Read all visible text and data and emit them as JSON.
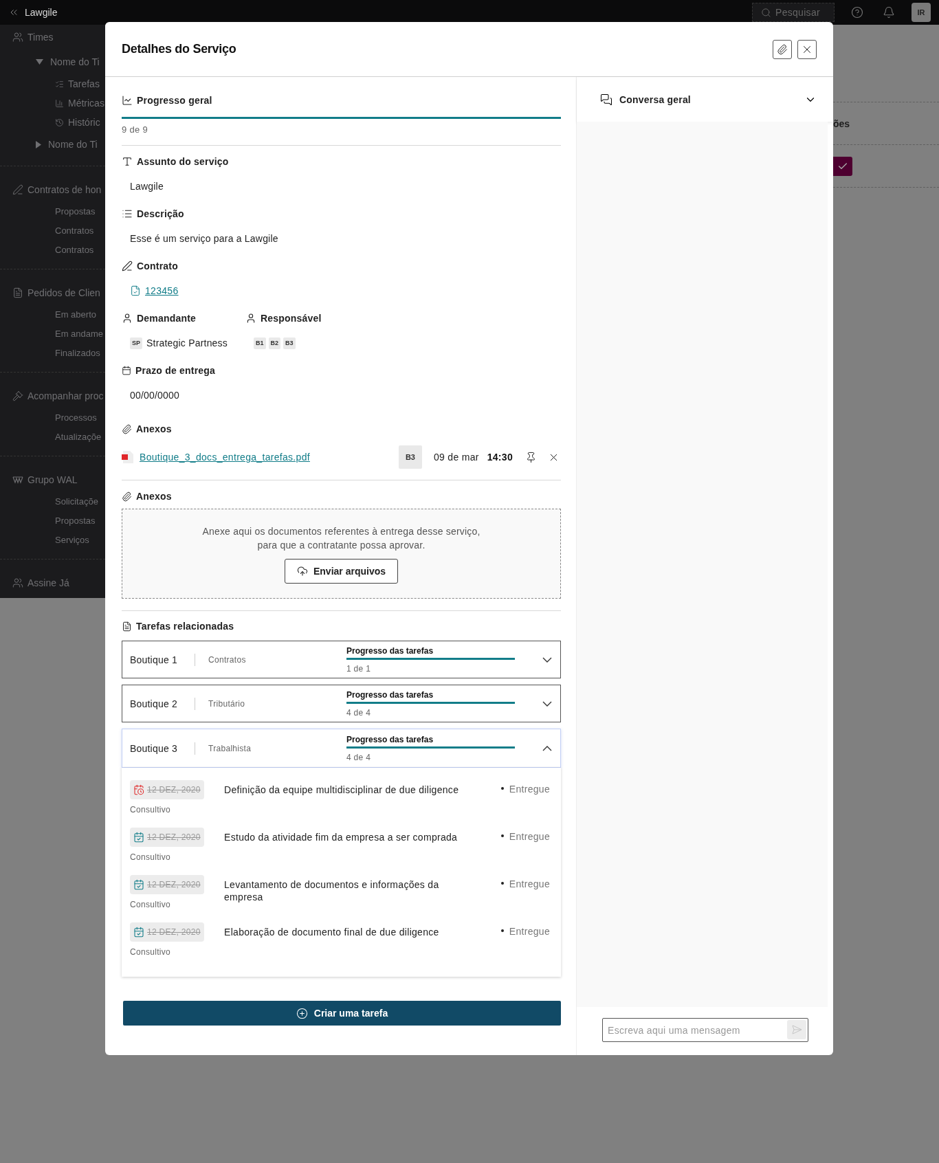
{
  "topbar": {
    "title": "Lawgile",
    "search": {
      "placeholder": "Pesquisar"
    },
    "avatar": "IR"
  },
  "sidebar": {
    "sections": [
      {
        "label": "Times",
        "items": [
          {
            "label": "Nome do Ti",
            "expanded": true,
            "children": [
              {
                "label": "Tarefas"
              },
              {
                "label": "Métricas"
              },
              {
                "label": "Históric"
              }
            ]
          },
          {
            "label": "Nome do Ti",
            "expanded": false
          }
        ]
      },
      {
        "label": "Contratos de hon",
        "items": [
          {
            "label": "Propostas"
          },
          {
            "label": "Contratos"
          },
          {
            "label": "Contratos"
          }
        ]
      },
      {
        "label": "Pedidos de Clien",
        "items": [
          {
            "label": "Em aberto"
          },
          {
            "label": "Em andame"
          },
          {
            "label": "Finalizados"
          }
        ]
      },
      {
        "label": "Acompanhar proc",
        "items": [
          {
            "label": "Processos"
          },
          {
            "label": "Atualizaçõe"
          }
        ]
      },
      {
        "label": "Grupo WAL",
        "items": [
          {
            "label": "Solicitaçõe"
          },
          {
            "label": "Propostas"
          },
          {
            "label": "Serviços"
          }
        ]
      },
      {
        "label": "Assine Já"
      }
    ]
  },
  "background": {
    "heading": "ões"
  },
  "modal": {
    "title": "Detalhes do Serviço",
    "progress": {
      "label": "Progresso geral",
      "level": 1,
      "reading": "9 de 9"
    },
    "subject": {
      "label": "Assunto do serviço",
      "value": "Lawgile"
    },
    "description": {
      "label": "Descrição",
      "value": "Esse é um serviço para a Lawgile"
    },
    "contract": {
      "label": "Contrato",
      "link": "123456"
    },
    "requester": {
      "label": "Demandante",
      "initials": "SP",
      "name": "Strategic Partness"
    },
    "responsible": {
      "label": "Responsável",
      "badges": [
        "B1",
        "B2",
        "B3"
      ]
    },
    "deadline": {
      "label": "Prazo de entrega",
      "value": "00/00/0000"
    },
    "attachments": {
      "label": "Anexos",
      "files": [
        {
          "name": "Boutique_3_docs_entrega_tarefas.pdf",
          "author": "B3",
          "date": "09 de mar",
          "time": "14:30"
        }
      ]
    },
    "upload": {
      "label": "Anexos",
      "hint": [
        "Anexe aqui os documentos referentes à entrega desse serviço,",
        "para que a contratante possa aprovar."
      ],
      "button": "Enviar arquivos"
    },
    "related": {
      "label": "Tarefas relacionadas",
      "groups": [
        {
          "name": "Boutique 1",
          "area": "Contratos",
          "progress_label": "Progresso das tarefas",
          "level": 1,
          "reading": "1 de 1",
          "expanded": false
        },
        {
          "name": "Boutique 2",
          "area": "Tributário",
          "progress_label": "Progresso das tarefas",
          "level": 1,
          "reading": "4 de 4",
          "expanded": false
        },
        {
          "name": "Boutique 3",
          "area": "Trabalhista",
          "progress_label": "Progresso das tarefas",
          "level": 1,
          "reading": "4 de 4",
          "expanded": true,
          "tasks": [
            {
              "kind": "late",
              "date": "12 DEZ, 2020",
              "category": "Consultivo",
              "title": "Definição da equipe multidisciplinar de due diligence",
              "status": "Entregue"
            },
            {
              "kind": "done",
              "date": "12 DEZ, 2020",
              "category": "Consultivo",
              "title": "Estudo da atividade fim da empresa a ser comprada",
              "status": "Entregue"
            },
            {
              "kind": "done",
              "date": "12 DEZ, 2020",
              "category": "Consultivo",
              "title": "Levantamento de documentos e informações da empresa",
              "status": "Entregue"
            },
            {
              "kind": "done",
              "date": "12 DEZ, 2020",
              "category": "Consultivo",
              "title": "Elaboração de documento final de due diligence",
              "status": "Entregue"
            }
          ]
        }
      ]
    },
    "create_button": "Criar uma tarefa",
    "chat": {
      "title": "Conversa geral",
      "expanded": false,
      "input": {
        "placeholder": "Escreva aqui uma mensagem"
      }
    }
  }
}
